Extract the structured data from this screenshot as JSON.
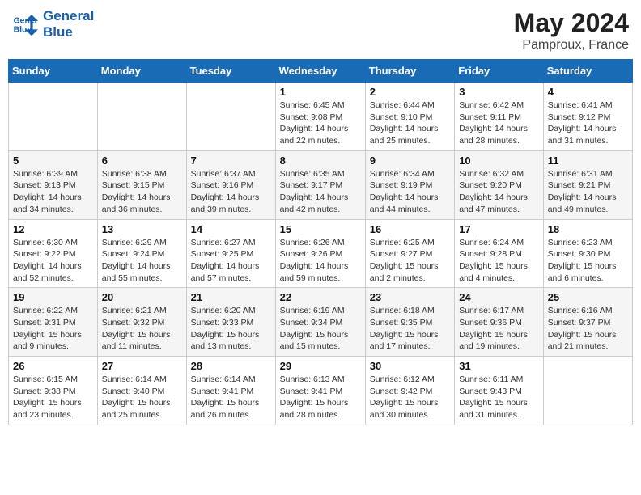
{
  "header": {
    "logo_line1": "General",
    "logo_line2": "Blue",
    "month": "May 2024",
    "location": "Pamproux, France"
  },
  "days_of_week": [
    "Sunday",
    "Monday",
    "Tuesday",
    "Wednesday",
    "Thursday",
    "Friday",
    "Saturday"
  ],
  "weeks": [
    [
      {
        "day": "",
        "info": ""
      },
      {
        "day": "",
        "info": ""
      },
      {
        "day": "",
        "info": ""
      },
      {
        "day": "1",
        "info": "Sunrise: 6:45 AM\nSunset: 9:08 PM\nDaylight: 14 hours\nand 22 minutes."
      },
      {
        "day": "2",
        "info": "Sunrise: 6:44 AM\nSunset: 9:10 PM\nDaylight: 14 hours\nand 25 minutes."
      },
      {
        "day": "3",
        "info": "Sunrise: 6:42 AM\nSunset: 9:11 PM\nDaylight: 14 hours\nand 28 minutes."
      },
      {
        "day": "4",
        "info": "Sunrise: 6:41 AM\nSunset: 9:12 PM\nDaylight: 14 hours\nand 31 minutes."
      }
    ],
    [
      {
        "day": "5",
        "info": "Sunrise: 6:39 AM\nSunset: 9:13 PM\nDaylight: 14 hours\nand 34 minutes."
      },
      {
        "day": "6",
        "info": "Sunrise: 6:38 AM\nSunset: 9:15 PM\nDaylight: 14 hours\nand 36 minutes."
      },
      {
        "day": "7",
        "info": "Sunrise: 6:37 AM\nSunset: 9:16 PM\nDaylight: 14 hours\nand 39 minutes."
      },
      {
        "day": "8",
        "info": "Sunrise: 6:35 AM\nSunset: 9:17 PM\nDaylight: 14 hours\nand 42 minutes."
      },
      {
        "day": "9",
        "info": "Sunrise: 6:34 AM\nSunset: 9:19 PM\nDaylight: 14 hours\nand 44 minutes."
      },
      {
        "day": "10",
        "info": "Sunrise: 6:32 AM\nSunset: 9:20 PM\nDaylight: 14 hours\nand 47 minutes."
      },
      {
        "day": "11",
        "info": "Sunrise: 6:31 AM\nSunset: 9:21 PM\nDaylight: 14 hours\nand 49 minutes."
      }
    ],
    [
      {
        "day": "12",
        "info": "Sunrise: 6:30 AM\nSunset: 9:22 PM\nDaylight: 14 hours\nand 52 minutes."
      },
      {
        "day": "13",
        "info": "Sunrise: 6:29 AM\nSunset: 9:24 PM\nDaylight: 14 hours\nand 55 minutes."
      },
      {
        "day": "14",
        "info": "Sunrise: 6:27 AM\nSunset: 9:25 PM\nDaylight: 14 hours\nand 57 minutes."
      },
      {
        "day": "15",
        "info": "Sunrise: 6:26 AM\nSunset: 9:26 PM\nDaylight: 14 hours\nand 59 minutes."
      },
      {
        "day": "16",
        "info": "Sunrise: 6:25 AM\nSunset: 9:27 PM\nDaylight: 15 hours\nand 2 minutes."
      },
      {
        "day": "17",
        "info": "Sunrise: 6:24 AM\nSunset: 9:28 PM\nDaylight: 15 hours\nand 4 minutes."
      },
      {
        "day": "18",
        "info": "Sunrise: 6:23 AM\nSunset: 9:30 PM\nDaylight: 15 hours\nand 6 minutes."
      }
    ],
    [
      {
        "day": "19",
        "info": "Sunrise: 6:22 AM\nSunset: 9:31 PM\nDaylight: 15 hours\nand 9 minutes."
      },
      {
        "day": "20",
        "info": "Sunrise: 6:21 AM\nSunset: 9:32 PM\nDaylight: 15 hours\nand 11 minutes."
      },
      {
        "day": "21",
        "info": "Sunrise: 6:20 AM\nSunset: 9:33 PM\nDaylight: 15 hours\nand 13 minutes."
      },
      {
        "day": "22",
        "info": "Sunrise: 6:19 AM\nSunset: 9:34 PM\nDaylight: 15 hours\nand 15 minutes."
      },
      {
        "day": "23",
        "info": "Sunrise: 6:18 AM\nSunset: 9:35 PM\nDaylight: 15 hours\nand 17 minutes."
      },
      {
        "day": "24",
        "info": "Sunrise: 6:17 AM\nSunset: 9:36 PM\nDaylight: 15 hours\nand 19 minutes."
      },
      {
        "day": "25",
        "info": "Sunrise: 6:16 AM\nSunset: 9:37 PM\nDaylight: 15 hours\nand 21 minutes."
      }
    ],
    [
      {
        "day": "26",
        "info": "Sunrise: 6:15 AM\nSunset: 9:38 PM\nDaylight: 15 hours\nand 23 minutes."
      },
      {
        "day": "27",
        "info": "Sunrise: 6:14 AM\nSunset: 9:40 PM\nDaylight: 15 hours\nand 25 minutes."
      },
      {
        "day": "28",
        "info": "Sunrise: 6:14 AM\nSunset: 9:41 PM\nDaylight: 15 hours\nand 26 minutes."
      },
      {
        "day": "29",
        "info": "Sunrise: 6:13 AM\nSunset: 9:41 PM\nDaylight: 15 hours\nand 28 minutes."
      },
      {
        "day": "30",
        "info": "Sunrise: 6:12 AM\nSunset: 9:42 PM\nDaylight: 15 hours\nand 30 minutes."
      },
      {
        "day": "31",
        "info": "Sunrise: 6:11 AM\nSunset: 9:43 PM\nDaylight: 15 hours\nand 31 minutes."
      },
      {
        "day": "",
        "info": ""
      }
    ]
  ]
}
